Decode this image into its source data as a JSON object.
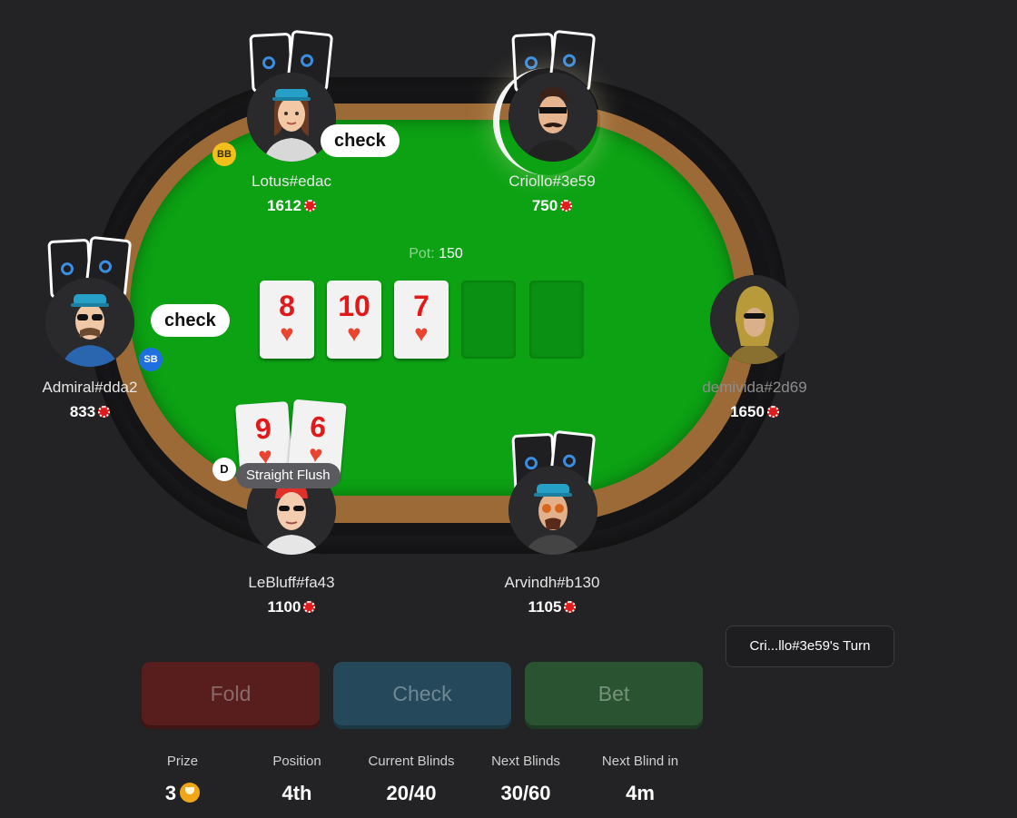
{
  "pot": {
    "label": "Pot:",
    "value": "150"
  },
  "board": [
    {
      "rank": "8",
      "suit": "♥"
    },
    {
      "rank": "10",
      "suit": "♥"
    },
    {
      "rank": "7",
      "suit": "♥"
    }
  ],
  "players": {
    "lotus": {
      "name": "Lotus#edac",
      "stack": "1612",
      "action": "check",
      "badge": "BB"
    },
    "criollo": {
      "name": "Criollo#3e59",
      "stack": "750"
    },
    "admiral": {
      "name": "Admiral#dda2",
      "stack": "833",
      "action": "check",
      "badge": "SB"
    },
    "demivida": {
      "name": "demivida#2d69",
      "stack": "1650"
    },
    "lebluff": {
      "name": "LeBluff#fa43",
      "stack": "1100",
      "badge": "D",
      "hand": "Straight Flush",
      "cards": [
        {
          "rank": "9",
          "suit": "♥"
        },
        {
          "rank": "6",
          "suit": "♥"
        }
      ]
    },
    "arvindh": {
      "name": "Arvindh#b130",
      "stack": "1105"
    }
  },
  "turn_status": "Cri...llo#3e59's Turn",
  "actions": {
    "fold": "Fold",
    "check": "Check",
    "bet": "Bet"
  },
  "stats": [
    {
      "label": "Prize",
      "value": "3"
    },
    {
      "label": "Position",
      "value": "4th"
    },
    {
      "label": "Current Blinds",
      "value": "20/40"
    },
    {
      "label": "Next Blinds",
      "value": "30/60"
    },
    {
      "label": "Next Blind in",
      "value": "4m"
    }
  ],
  "colors": {
    "felt": "#0ca214",
    "wood": "#9c6a36",
    "background": "#232325",
    "hearts": "#e01a1a"
  }
}
